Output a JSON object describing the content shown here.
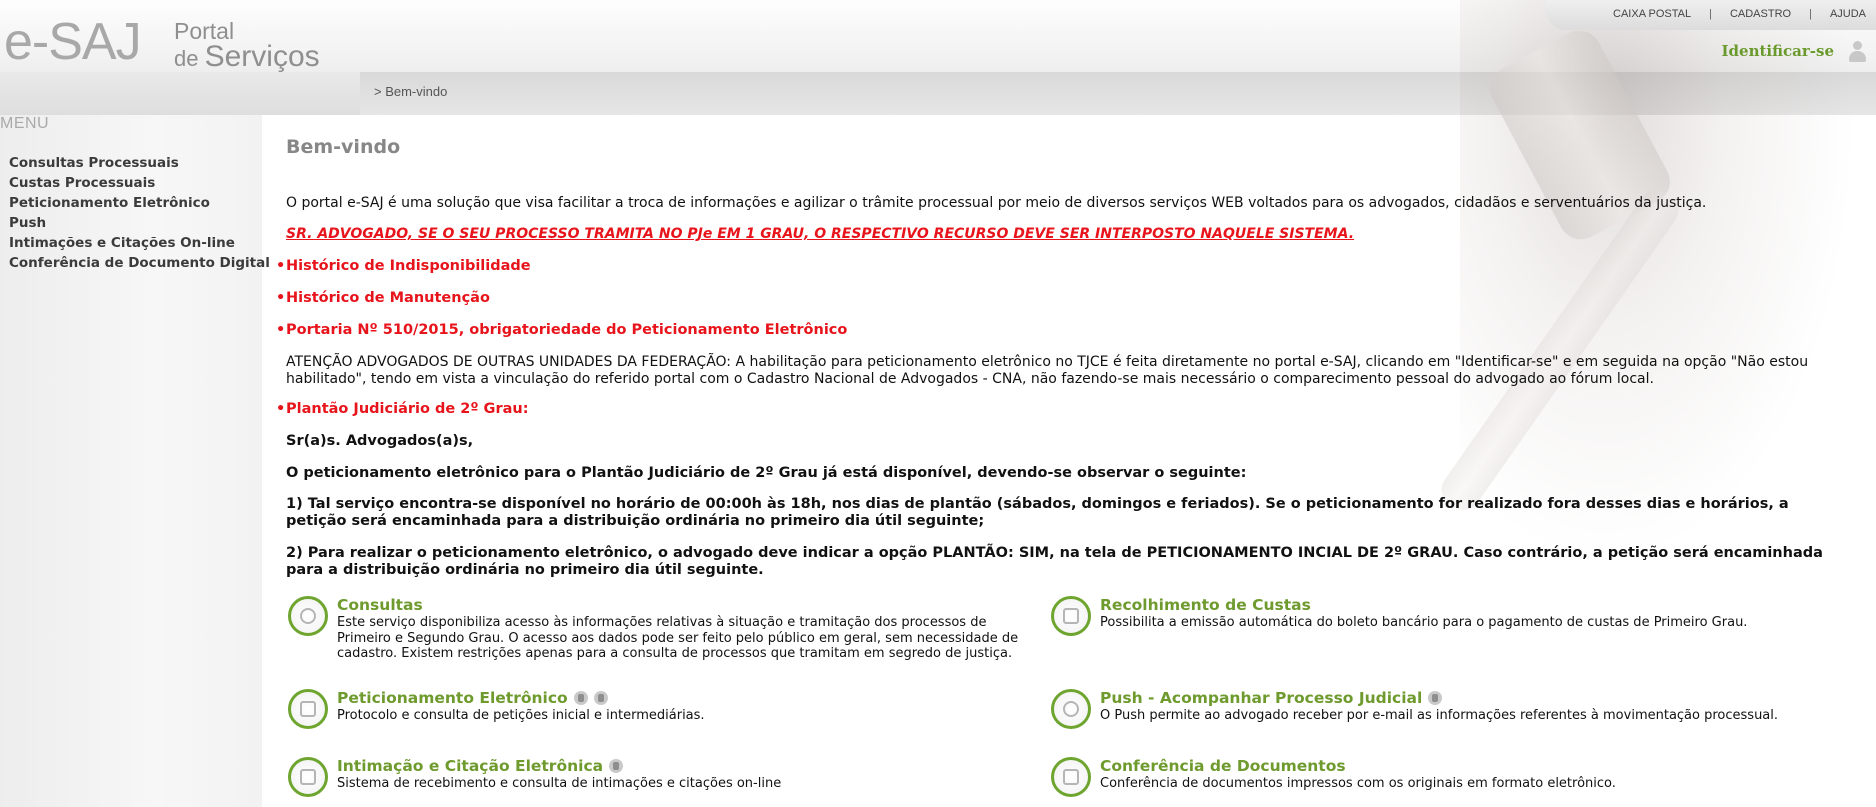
{
  "header": {
    "logo_esaj": "e-SAJ",
    "logo_portal": "Portal",
    "logo_de": "de ",
    "logo_servicos": "Serviços",
    "breadcrumb": "> Bem-vindo",
    "topnav": [
      "CAIXA POSTAL",
      "CADASTRO",
      "AJUDA"
    ],
    "topnav_separator": "|",
    "login_label": "Identificar-se"
  },
  "sidebar": {
    "title": "MENU",
    "items": [
      "Consultas Processuais",
      "Custas Processuais",
      "Peticionamento Eletrônico",
      "Push",
      "Intimações e Citações On-line",
      "Conferência de Documento Digital"
    ]
  },
  "main": {
    "title": "Bem-vindo",
    "intro": "O portal e-SAJ é uma solução que visa facilitar a troca de informações e agilizar o trâmite processual por meio de diversos serviços WEB voltados para os advogados, cidadãos e serventuários da justiça.",
    "warning": "SR. ADVOGADO, SE O SEU PROCESSO TRAMITA NO PJe EM 1 GRAU, O RESPECTIVO RECURSO DEVE SER INTERPOSTO NAQUELE SISTEMA.",
    "bullet": "•",
    "links": [
      "Histórico de Indisponibilidade",
      "Histórico de Manutenção",
      "Portaria Nº 510/2015, obrigatoriedade do Peticionamento Eletrônico"
    ],
    "atencao": "ATENÇÃO ADVOGADOS DE OUTRAS UNIDADES DA FEDERAÇÃO: A habilitação para peticionamento eletrônico no TJCE é feita diretamente no portal e-SAJ, clicando em \"Identificar-se\" e em seguida na opção \"Não estou habilitado\", tendo em vista a vinculação do referido portal com o Cadastro Nacional de Advogados - CNA, não fazendo-se mais necessário o comparecimento pessoal do advogado ao fórum local.",
    "plantao_link": "Plantão Judiciário de 2º Grau:",
    "plantao_greeting": "Sr(a)s. Advogados(a)s,",
    "plantao_intro": "O peticionamento eletrônico para o Plantão Judiciário de 2º Grau já está disponível, devendo-se observar o seguinte:",
    "plantao_item1": "1) Tal serviço encontra-se disponível no horário de 00:00h às 18h, nos dias de plantão (sábados, domingos e feriados). Se o peticionamento for realizado fora desses dias e horários, a petição será encaminhada para a distribuição ordinária no primeiro dia útil seguinte;",
    "plantao_item2": "2) Para realizar o peticionamento eletrônico, o advogado deve indicar a opção PLANTÃO: SIM, na tela de PETICIONAMENTO INCIAL DE 2º GRAU. Caso contrário, a petição será encaminhada para a distribuição ordinária no primeiro dia útil seguinte."
  },
  "services": [
    {
      "title": "Consultas",
      "desc": "Este serviço disponibiliza acesso às informações relativas à situação e tramitação dos processos de Primeiro e Segundo Grau. O acesso aos dados pode ser feito pelo público em geral, sem necessidade de cadastro. Existem restrições apenas para a consulta de processos que tramitam em segredo de justiça.",
      "icon": "magnifier-icon"
    },
    {
      "title": "Recolhimento de Custas",
      "desc": "Possibilita a emissão automática do boleto bancário para o pagamento de custas de Primeiro Grau.",
      "icon": "money-document-icon"
    },
    {
      "title": "Peticionamento Eletrônico",
      "desc": "Protocolo e consulta de petições inicial e intermediárias.",
      "icon": "petition-icon"
    },
    {
      "title": "Push - Acompanhar Processo Judicial",
      "desc": "O Push permite ao advogado receber por e-mail as informações referentes à movimentação processual.",
      "icon": "parachute-icon"
    },
    {
      "title": "Intimação e Citação Eletrônica",
      "desc": "Sistema de recebimento e consulta de intimações e citações on-line",
      "icon": "summons-icon"
    },
    {
      "title": "Conferência de Documentos",
      "desc": "Conferência de documentos impressos com os originais em formato eletrônico.",
      "icon": "documents-icon"
    }
  ],
  "colors": {
    "accent_green": "#6e9a2e",
    "alert_red": "#e8141b",
    "menu_gray": "#aaaaaa"
  }
}
